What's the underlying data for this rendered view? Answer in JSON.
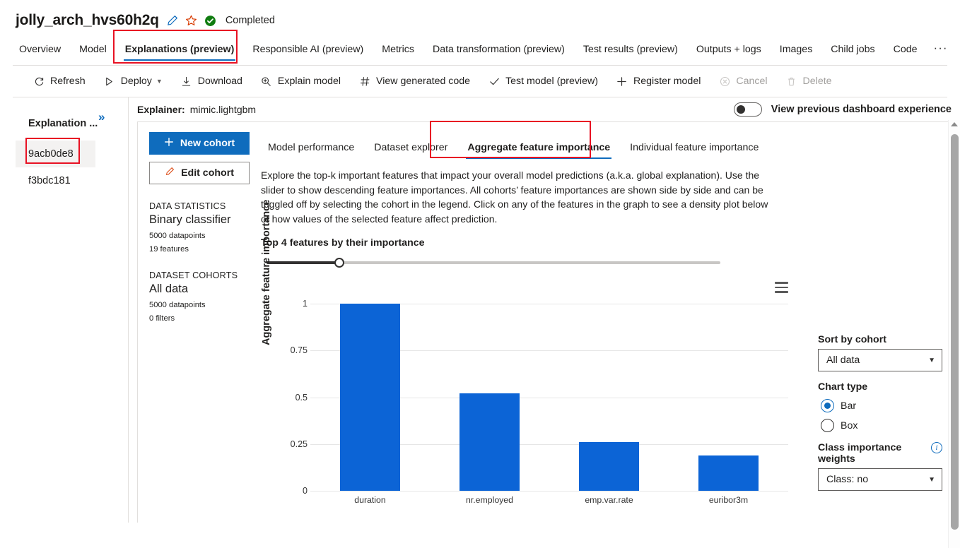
{
  "header": {
    "title": "jolly_arch_hvs60h2q",
    "edit_icon": "pencil-icon",
    "favorite_icon": "star-icon",
    "status": "Completed",
    "status_color": "#107c10"
  },
  "tabs": [
    {
      "label": "Overview",
      "selected": false
    },
    {
      "label": "Model",
      "selected": false
    },
    {
      "label": "Explanations (preview)",
      "selected": true
    },
    {
      "label": "Responsible AI (preview)",
      "selected": false
    },
    {
      "label": "Metrics",
      "selected": false
    },
    {
      "label": "Data transformation (preview)",
      "selected": false
    },
    {
      "label": "Test results (preview)",
      "selected": false
    },
    {
      "label": "Outputs + logs",
      "selected": false
    },
    {
      "label": "Images",
      "selected": false
    },
    {
      "label": "Child jobs",
      "selected": false
    },
    {
      "label": "Code",
      "selected": false
    }
  ],
  "tab_overflow": "···",
  "commands": [
    {
      "label": "Refresh",
      "icon": "refresh-icon",
      "disabled": false,
      "chevron": false
    },
    {
      "label": "Deploy",
      "icon": "play-icon",
      "disabled": false,
      "chevron": true
    },
    {
      "label": "Download",
      "icon": "download-icon",
      "disabled": false,
      "chevron": false
    },
    {
      "label": "Explain model",
      "icon": "magnifier-plus-icon",
      "disabled": false,
      "chevron": false
    },
    {
      "label": "View generated code",
      "icon": "hash-icon",
      "disabled": false,
      "chevron": false
    },
    {
      "label": "Test model (preview)",
      "icon": "checkmark-icon",
      "disabled": false,
      "chevron": false
    },
    {
      "label": "Register model",
      "icon": "plus-icon",
      "disabled": false,
      "chevron": false
    },
    {
      "label": "Cancel",
      "icon": "cancel-circle-icon",
      "disabled": true,
      "chevron": false
    },
    {
      "label": "Delete",
      "icon": "trash-icon",
      "disabled": true,
      "chevron": false
    }
  ],
  "explanation_list": {
    "header": "Explanation ...",
    "expand_icon": "»",
    "rows": [
      {
        "id": "9acb0de8",
        "selected": true
      },
      {
        "id": "f3bdc181",
        "selected": false
      }
    ]
  },
  "explainer": {
    "label": "Explainer:",
    "value": "mimic.lightgbm"
  },
  "dashboard_toggle": {
    "label": "View previous dashboard experience",
    "enabled": false
  },
  "cohort_panel": {
    "new_cohort": "New cohort",
    "edit_cohort": "Edit cohort",
    "data_statistics_caption": "DATA STATISTICS",
    "data_statistics_title": "Binary classifier",
    "data_statistics_lines": [
      "5000 datapoints",
      "19 features"
    ],
    "dataset_cohorts_caption": "DATASET COHORTS",
    "dataset_cohorts_title": "All data",
    "dataset_cohorts_lines": [
      "5000 datapoints",
      "0 filters"
    ]
  },
  "pivots": [
    {
      "label": "Model performance",
      "selected": false
    },
    {
      "label": "Dataset explorer",
      "selected": false
    },
    {
      "label": "Aggregate feature importance",
      "selected": true
    },
    {
      "label": "Individual feature importance",
      "selected": false
    }
  ],
  "description": "Explore the top-k important features that impact your overall model predictions (a.k.a. global explanation). Use the slider to show descending feature importances. All cohorts’ feature importances are shown side by side and can be toggled off by selecting the cohort in the legend. Click on any of the features in the graph to see a density plot below of how values of the selected feature affect prediction.",
  "slider": {
    "label": "Top 4 features by their importance",
    "value": 4,
    "percent": 16
  },
  "chart_menu_icon": "hamburger-menu-icon",
  "controls": {
    "sort_by_cohort_label": "Sort by cohort",
    "sort_by_cohort_value": "All data",
    "chart_type_label": "Chart type",
    "chart_type_options": [
      {
        "label": "Bar",
        "checked": true
      },
      {
        "label": "Box",
        "checked": false
      }
    ],
    "class_weights_label": "Class importance weights",
    "class_weights_value": "Class: no",
    "info_icon": "info-icon"
  },
  "chart_data": {
    "type": "bar",
    "title": "",
    "xlabel": "",
    "ylabel": "Aggregate feature importance",
    "categories": [
      "duration",
      "nr.employed",
      "emp.var.rate",
      "euribor3m"
    ],
    "values": [
      1.0,
      0.52,
      0.26,
      0.19
    ],
    "yticks": [
      "0",
      "0.25",
      "0.5",
      "0.75",
      "1"
    ],
    "ytick_values": [
      0,
      0.25,
      0.5,
      0.75,
      1
    ],
    "ylim": [
      0,
      1.08
    ],
    "grid": true,
    "legend": "none",
    "series_color": "#0c64d6"
  }
}
